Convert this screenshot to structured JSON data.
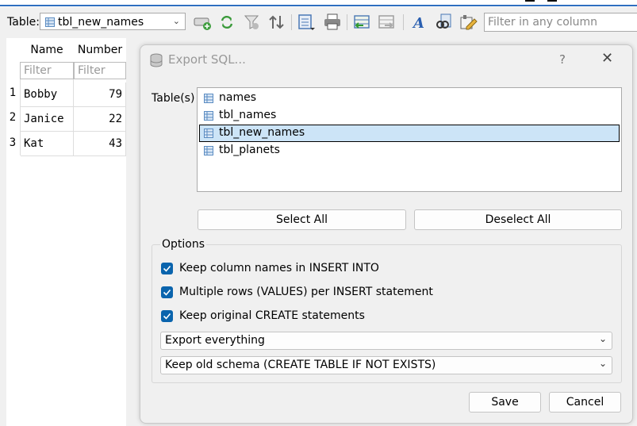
{
  "toolbar": {
    "table_label": "Table:",
    "table_value": "tbl_new_names",
    "filter_placeholder": "Filter in any column"
  },
  "grid": {
    "columns": [
      "Name",
      "Number"
    ],
    "filter_placeholder": "Filter",
    "rows": [
      {
        "num": "1",
        "name": "Bobby",
        "number": "79"
      },
      {
        "num": "2",
        "name": "Janice",
        "number": "22"
      },
      {
        "num": "3",
        "name": "Kat",
        "number": "43"
      }
    ]
  },
  "dialog": {
    "title": "Export SQL...",
    "help": "?",
    "close": "✕",
    "tables_label": "Table(s)",
    "tables": [
      "names",
      "tbl_names",
      "tbl_new_names",
      "tbl_planets"
    ],
    "selected_table": "tbl_new_names",
    "select_all": "Select All",
    "deselect_all": "Deselect All",
    "options_title": "Options",
    "options": [
      {
        "label": "Keep column names in INSERT INTO",
        "checked": true
      },
      {
        "label": "Multiple rows (VALUES) per INSERT statement",
        "checked": true
      },
      {
        "label": "Keep original CREATE statements",
        "checked": true
      }
    ],
    "export_mode": "Export everything",
    "schema_mode": "Keep old schema (CREATE TABLE IF NOT EXISTS)",
    "save": "Save",
    "cancel": "Cancel"
  },
  "colors": {
    "accent": "#0a64ad",
    "selection": "#cce4f7"
  }
}
